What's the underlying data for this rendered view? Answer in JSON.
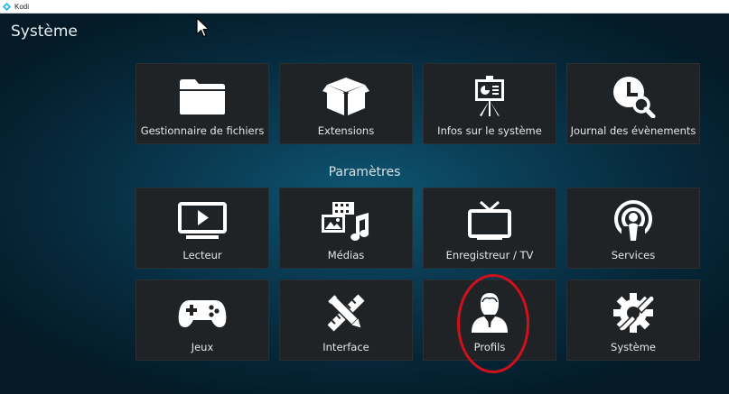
{
  "window": {
    "title": "Kodi"
  },
  "header": {
    "title": "Système"
  },
  "section": {
    "title": "Paramètres"
  },
  "top_row": [
    {
      "label": "Gestionnaire de fichiers",
      "icon": "folder-icon"
    },
    {
      "label": "Extensions",
      "icon": "box-icon"
    },
    {
      "label": "Infos sur le système",
      "icon": "presentation-icon"
    },
    {
      "label": "Journal des évènements",
      "icon": "clock-search-icon"
    }
  ],
  "settings": [
    {
      "label": "Lecteur",
      "icon": "monitor-play-icon"
    },
    {
      "label": "Médias",
      "icon": "media-icon"
    },
    {
      "label": "Enregistreur / TV",
      "icon": "tv-icon"
    },
    {
      "label": "Services",
      "icon": "podcast-icon"
    },
    {
      "label": "Jeux",
      "icon": "gamepad-icon"
    },
    {
      "label": "Interface",
      "icon": "pencil-ruler-icon"
    },
    {
      "label": "Profils",
      "icon": "user-icon"
    },
    {
      "label": "Système",
      "icon": "gear-wrench-icon"
    }
  ],
  "colors": {
    "tile": "#1f2326",
    "highlight": "#d0101a",
    "background": "#0a3d55"
  }
}
